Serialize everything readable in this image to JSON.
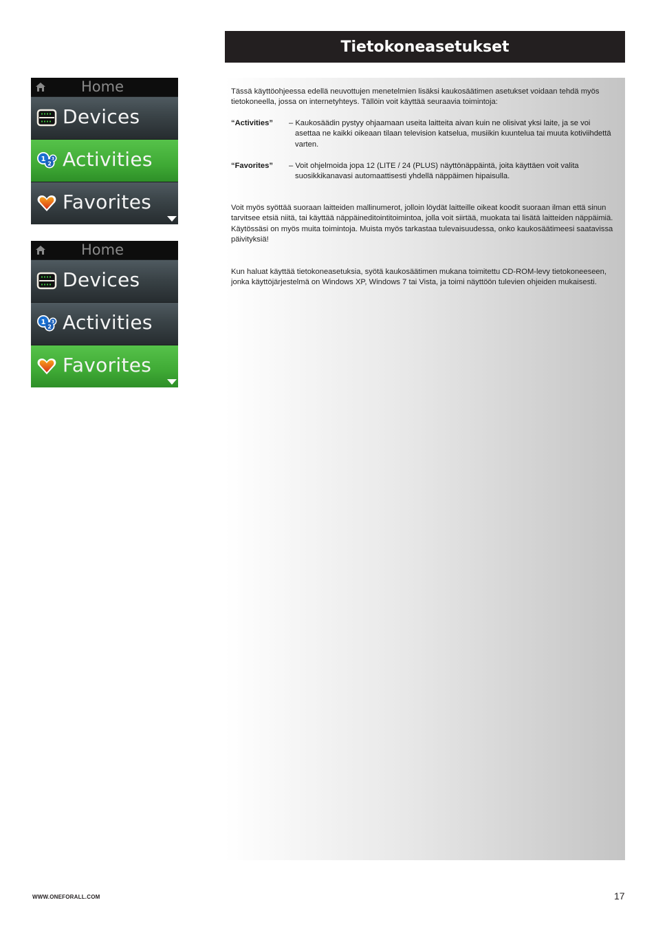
{
  "page": {
    "title": "Tietokoneasetukset",
    "intro": "Tässä käyttöohjeessa edellä neuvottujen menetelmien lisäksi kaukosäätimen asetukset voidaan tehdä myös tietokoneella, jossa on internetyhteys. Tällöin voit käyttää seuraavia toimintoja:",
    "definitions": [
      {
        "term": "“Activities”",
        "first_line": "– Kaukosäädin pystyy ohjaamaan useita laitteita aivan kuin ne olisivat yksi laite, ja se voi",
        "rest": "asettaa ne kaikki oikeaan tilaan television katselua, musiikin kuuntelua tai muuta kotiviihdettä varten."
      },
      {
        "term": "“Favorites”",
        "first_line": "– Voit ohjelmoida jopa 12 (LITE / 24 (PLUS) näyttönäppäintä, joita käyttäen voit valita",
        "rest": "suosikkikanavasi automaattisesti yhdellä näppäimen hipaisulla."
      }
    ],
    "paragraph2": "Voit myös syöttää suoraan laitteiden mallinumerot, jolloin löydät laitteille oikeat koodit suoraan ilman että sinun tarvitsee etsiä niitä, tai käyttää näppäineditointitoimintoa, jolla voit siirtää, muokata tai lisätä laitteiden näppäimiä. Käytössäsi on myös muita toimintoja. Muista myös tarkastaa tulevaisuudessa, onko kaukosäätimeesi saatavissa päivityksiä!",
    "paragraph3": "Kun haluat käyttää tietokoneasetuksia, syötä kaukosäätimen mukana toimitettu CD-ROM-levy tietokoneeseen, jonka käyttöjärjestelmä on Windows XP, Windows 7 tai Vista, ja toimi näyttöön tulevien ohjeiden mukaisesti."
  },
  "screens": [
    {
      "header": "Home",
      "items": [
        {
          "label": "Devices",
          "icon": "devices-icon"
        },
        {
          "label": "Activities",
          "icon": "activities-icon",
          "selected": true
        },
        {
          "label": "Favorites",
          "icon": "favorites-icon"
        }
      ]
    },
    {
      "header": "Home",
      "items": [
        {
          "label": "Devices",
          "icon": "devices-icon"
        },
        {
          "label": "Activities",
          "icon": "activities-icon"
        },
        {
          "label": "Favorites",
          "icon": "favorites-icon",
          "selected": true
        }
      ]
    }
  ],
  "footer": {
    "url": "WWW.ONEFORALL.COM",
    "page_number": "17"
  },
  "colors": {
    "title_bg": "#231f20",
    "selected_green": "#3faa35",
    "menu_dark": "#3a4347"
  }
}
